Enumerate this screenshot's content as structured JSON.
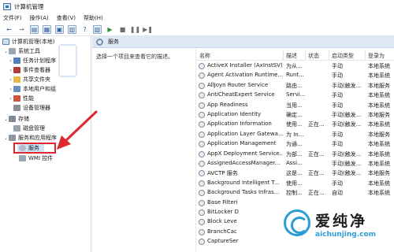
{
  "window": {
    "title": "计算机管理"
  },
  "menu": [
    "文件(F)",
    "操作(A)",
    "查看(V)",
    "帮助(H)"
  ],
  "toolbar": {
    "icons": [
      "back-arrow-icon",
      "forward-arrow-icon",
      "up-folder-icon",
      "show-hide-tree-icon",
      "refresh-icon",
      "export-list-icon",
      "help-icon",
      "properties-icon",
      "play-icon",
      "stop-icon",
      "pause-icon",
      "restart-icon"
    ]
  },
  "tree": {
    "root": "计算机管理(本地)",
    "items": [
      {
        "label": "系统工具"
      },
      {
        "label": "任务计划程序"
      },
      {
        "label": "事件查看器"
      },
      {
        "label": "共享文件夹"
      },
      {
        "label": "本地用户和组"
      },
      {
        "label": "性能"
      },
      {
        "label": "设备管理器"
      },
      {
        "label": "存储"
      },
      {
        "label": "磁盘管理"
      },
      {
        "label": "服务和应用程序"
      },
      {
        "label": "服务"
      },
      {
        "label": "WMI 控件"
      }
    ]
  },
  "pane": {
    "header": "服务",
    "description": "选择一个项目来查看它的描述。",
    "columns": [
      "名称",
      "描述",
      "状态",
      "启动类型",
      "登录为"
    ]
  },
  "services": [
    {
      "name": "ActiveX Installer (AxInstSV)",
      "desc": "为从...",
      "status": "",
      "startup": "手动",
      "logon": "本地系统"
    },
    {
      "name": "Agent Activation Runtime...",
      "desc": "Runt...",
      "status": "",
      "startup": "手动",
      "logon": "本地系统"
    },
    {
      "name": "AllJoyn Router Service",
      "desc": "路由...",
      "status": "",
      "startup": "手动(触发...",
      "logon": "本地服务"
    },
    {
      "name": "AntiCheatExpert Service",
      "desc": "Servi...",
      "status": "",
      "startup": "手动",
      "logon": "本地系统"
    },
    {
      "name": "App Readiness",
      "desc": "当用...",
      "status": "",
      "startup": "手动",
      "logon": "本地系统"
    },
    {
      "name": "Application Identity",
      "desc": "确定...",
      "status": "",
      "startup": "手动(触发...",
      "logon": "本地服务"
    },
    {
      "name": "Application Information",
      "desc": "使用...",
      "status": "正在...",
      "startup": "手动(触发...",
      "logon": "本地系统"
    },
    {
      "name": "Application Layer Gatewa...",
      "desc": "为 In...",
      "status": "",
      "startup": "手动",
      "logon": "本地服务"
    },
    {
      "name": "Application Management",
      "desc": "为通...",
      "status": "",
      "startup": "手动",
      "logon": "本地系统"
    },
    {
      "name": "AppX Deployment Service...",
      "desc": "为部...",
      "status": "正在...",
      "startup": "手动(触发...",
      "logon": "本地系统"
    },
    {
      "name": "AssignedAccessManager...",
      "desc": "Assi...",
      "status": "",
      "startup": "手动(触发...",
      "logon": "本地系统"
    },
    {
      "name": "AVCTP 服务",
      "desc": "这是...",
      "status": "正在...",
      "startup": "手动(触发...",
      "logon": "本地服务"
    },
    {
      "name": "Background Intelligent T...",
      "desc": "使用...",
      "status": "",
      "startup": "手动",
      "logon": "本地系统"
    },
    {
      "name": "Background Tasks Infras...",
      "desc": "控制...",
      "status": "正在...",
      "startup": "自动",
      "logon": "本地系统"
    },
    {
      "name": "Base Filteri",
      "desc": "",
      "status": "",
      "startup": "",
      "logon": ""
    },
    {
      "name": "BitLocker D",
      "desc": "",
      "status": "",
      "startup": "",
      "logon": ""
    },
    {
      "name": "Block Leve",
      "desc": "",
      "status": "",
      "startup": "",
      "logon": ""
    },
    {
      "name": "BranchCac",
      "desc": "",
      "status": "",
      "startup": "",
      "logon": ""
    },
    {
      "name": "CaptureSer",
      "desc": "",
      "status": "",
      "startup": "",
      "logon": ""
    }
  ],
  "watermark": {
    "cn": "爱纯净",
    "en": "aichunjing.com"
  },
  "colors": {
    "highlight": "#e0262f",
    "header_bg": "#dfe9f5",
    "selection": "#cde3f7",
    "watermark_blue": "#2d9bd6"
  }
}
